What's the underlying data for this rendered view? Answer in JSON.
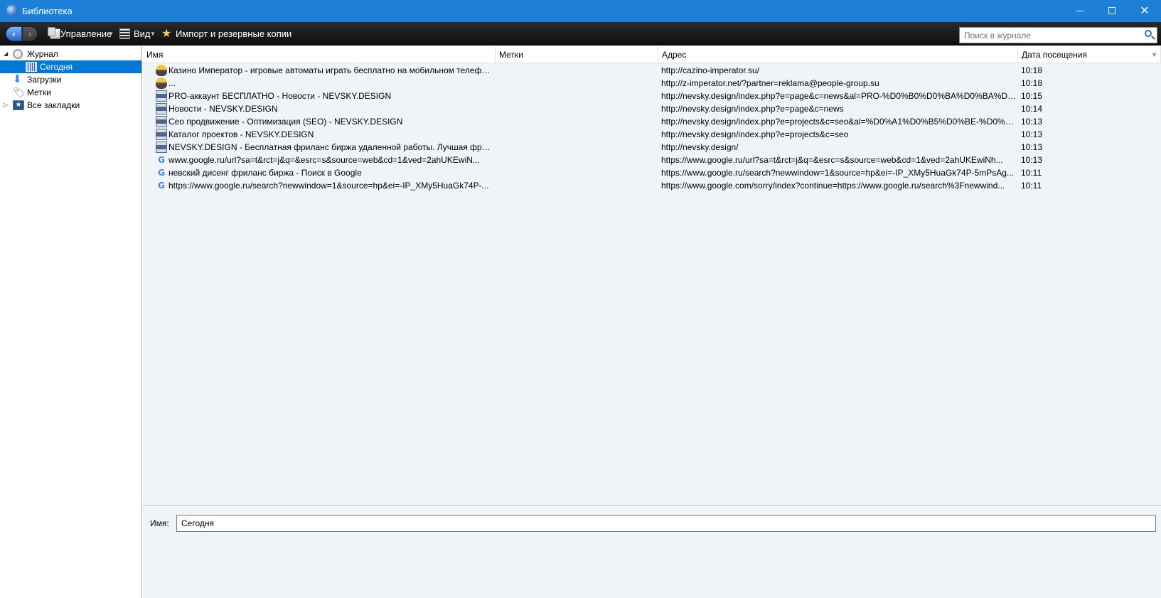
{
  "window": {
    "title": "Библиотека"
  },
  "toolbar": {
    "manage_label": "Управление",
    "view_label": "Вид",
    "import_label": "Импорт и резервные копии",
    "search_placeholder": "Поиск в журнале"
  },
  "sidebar": {
    "items": [
      {
        "label": "Журнал",
        "icon": "clock-icon",
        "expanded": true
      },
      {
        "label": "Сегодня",
        "icon": "calendar-icon",
        "selected": true
      },
      {
        "label": "Загрузки",
        "icon": "download-icon"
      },
      {
        "label": "Метки",
        "icon": "tag-icon"
      },
      {
        "label": "Все закладки",
        "icon": "star-icon",
        "expanded": false
      }
    ]
  },
  "table": {
    "columns": [
      "Имя",
      "Метки",
      "Адрес",
      "Дата посещения"
    ],
    "rows": [
      {
        "icon": "casino-icon",
        "name": "Казино Император - игровые автоматы играть бесплатно на мобильном телефо...",
        "tags": "",
        "url": "http://cazino-imperator.su/",
        "date": "10:18"
      },
      {
        "icon": "casino-icon",
        "name": "...",
        "tags": "",
        "url": "http://z-imperator.net/?partner=reklama@people-group.su",
        "date": "10:18"
      },
      {
        "icon": "page-icon",
        "name": "PRO-аккаунт БЕСПЛАТНО - Новости - NEVSKY.DESIGN",
        "tags": "",
        "url": "http://nevsky.design/index.php?e=page&c=news&al=PRO-%D0%B0%D0%BA%D0%BA%D0...",
        "date": "10:15"
      },
      {
        "icon": "page-icon",
        "name": "Новости - NEVSKY.DESIGN",
        "tags": "",
        "url": "http://nevsky.design/index.php?e=page&c=news",
        "date": "10:14"
      },
      {
        "icon": "page-icon",
        "name": "Сео продвижение - Оптимизация (SEO) - NEVSKY.DESIGN",
        "tags": "",
        "url": "http://nevsky.design/index.php?e=projects&c=seo&al=%D0%A1%D0%B5%D0%BE-%D0%BF...",
        "date": "10:13"
      },
      {
        "icon": "page-icon",
        "name": "Каталог проектов - NEVSKY.DESIGN",
        "tags": "",
        "url": "http://nevsky.design/index.php?e=projects&c=seo",
        "date": "10:13"
      },
      {
        "icon": "page-icon",
        "name": "NEVSKY.DESIGN - Бесплатная фриланс биржа удаленной работы. Лучшая фрила...",
        "tags": "",
        "url": "http://nevsky.design/",
        "date": "10:13"
      },
      {
        "icon": "google-icon",
        "name": "www.google.ru/url?sa=t&rct=j&q=&esrc=s&source=web&cd=1&ved=2ahUKEwiN...",
        "tags": "",
        "url": "https://www.google.ru/url?sa=t&rct=j&q=&esrc=s&source=web&cd=1&ved=2ahUKEwiNh...",
        "date": "10:13"
      },
      {
        "icon": "google-icon",
        "name": "невский дисенг фриланс биржа - Поиск в Google",
        "tags": "",
        "url": "https://www.google.ru/search?newwindow=1&source=hp&ei=-IP_XMy5HuaGk74P-5mPsAg...",
        "date": "10:11"
      },
      {
        "icon": "google-icon",
        "name": "https://www.google.ru/search?newwindow=1&source=hp&ei=-IP_XMy5HuaGk74P-...",
        "tags": "",
        "url": "https://www.google.com/sorry/index?continue=https://www.google.ru/search%3Fnewwind...",
        "date": "10:11"
      }
    ]
  },
  "details": {
    "name_label": "Имя:",
    "name_value": "Сегодня"
  },
  "colors": {
    "titlebar": "#1e7fd8",
    "selection": "#0078d7",
    "list_background": "#f0f4f9"
  }
}
